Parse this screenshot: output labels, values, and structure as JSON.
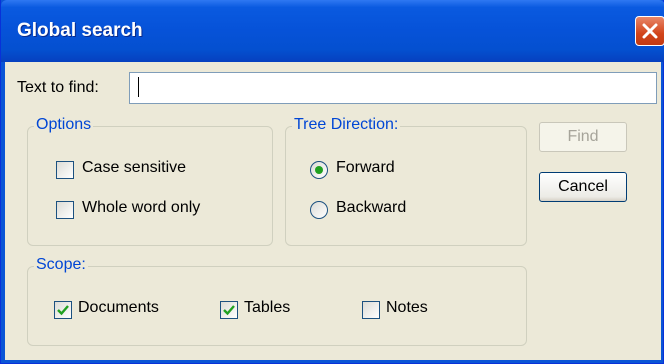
{
  "window": {
    "title": "Global search"
  },
  "search": {
    "label": "Text to find:",
    "value": ""
  },
  "options": {
    "legend": "Options",
    "case_sensitive": {
      "label": "Case sensitive",
      "checked": false
    },
    "whole_word": {
      "label": "Whole word only",
      "checked": false
    }
  },
  "direction": {
    "legend": "Tree Direction:",
    "forward": {
      "label": "Forward",
      "selected": true
    },
    "backward": {
      "label": "Backward",
      "selected": false
    }
  },
  "scope": {
    "legend": "Scope:",
    "documents": {
      "label": "Documents",
      "checked": true
    },
    "tables": {
      "label": "Tables",
      "checked": true
    },
    "notes": {
      "label": "Notes",
      "checked": false
    }
  },
  "buttons": {
    "find": "Find",
    "cancel": "Cancel"
  },
  "icons": {
    "close": "close-icon",
    "check": "checkmark-icon"
  }
}
